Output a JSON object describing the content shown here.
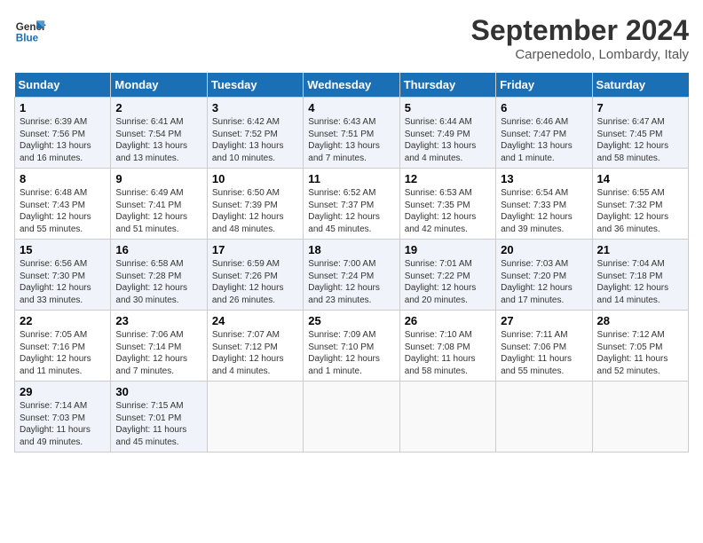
{
  "header": {
    "logo_line1": "General",
    "logo_line2": "Blue",
    "month_title": "September 2024",
    "location": "Carpenedolo, Lombardy, Italy"
  },
  "columns": [
    "Sunday",
    "Monday",
    "Tuesday",
    "Wednesday",
    "Thursday",
    "Friday",
    "Saturday"
  ],
  "weeks": [
    [
      {
        "day": "1",
        "info": "Sunrise: 6:39 AM\nSunset: 7:56 PM\nDaylight: 13 hours\nand 16 minutes."
      },
      {
        "day": "2",
        "info": "Sunrise: 6:41 AM\nSunset: 7:54 PM\nDaylight: 13 hours\nand 13 minutes."
      },
      {
        "day": "3",
        "info": "Sunrise: 6:42 AM\nSunset: 7:52 PM\nDaylight: 13 hours\nand 10 minutes."
      },
      {
        "day": "4",
        "info": "Sunrise: 6:43 AM\nSunset: 7:51 PM\nDaylight: 13 hours\nand 7 minutes."
      },
      {
        "day": "5",
        "info": "Sunrise: 6:44 AM\nSunset: 7:49 PM\nDaylight: 13 hours\nand 4 minutes."
      },
      {
        "day": "6",
        "info": "Sunrise: 6:46 AM\nSunset: 7:47 PM\nDaylight: 13 hours\nand 1 minute."
      },
      {
        "day": "7",
        "info": "Sunrise: 6:47 AM\nSunset: 7:45 PM\nDaylight: 12 hours\nand 58 minutes."
      }
    ],
    [
      {
        "day": "8",
        "info": "Sunrise: 6:48 AM\nSunset: 7:43 PM\nDaylight: 12 hours\nand 55 minutes."
      },
      {
        "day": "9",
        "info": "Sunrise: 6:49 AM\nSunset: 7:41 PM\nDaylight: 12 hours\nand 51 minutes."
      },
      {
        "day": "10",
        "info": "Sunrise: 6:50 AM\nSunset: 7:39 PM\nDaylight: 12 hours\nand 48 minutes."
      },
      {
        "day": "11",
        "info": "Sunrise: 6:52 AM\nSunset: 7:37 PM\nDaylight: 12 hours\nand 45 minutes."
      },
      {
        "day": "12",
        "info": "Sunrise: 6:53 AM\nSunset: 7:35 PM\nDaylight: 12 hours\nand 42 minutes."
      },
      {
        "day": "13",
        "info": "Sunrise: 6:54 AM\nSunset: 7:33 PM\nDaylight: 12 hours\nand 39 minutes."
      },
      {
        "day": "14",
        "info": "Sunrise: 6:55 AM\nSunset: 7:32 PM\nDaylight: 12 hours\nand 36 minutes."
      }
    ],
    [
      {
        "day": "15",
        "info": "Sunrise: 6:56 AM\nSunset: 7:30 PM\nDaylight: 12 hours\nand 33 minutes."
      },
      {
        "day": "16",
        "info": "Sunrise: 6:58 AM\nSunset: 7:28 PM\nDaylight: 12 hours\nand 30 minutes."
      },
      {
        "day": "17",
        "info": "Sunrise: 6:59 AM\nSunset: 7:26 PM\nDaylight: 12 hours\nand 26 minutes."
      },
      {
        "day": "18",
        "info": "Sunrise: 7:00 AM\nSunset: 7:24 PM\nDaylight: 12 hours\nand 23 minutes."
      },
      {
        "day": "19",
        "info": "Sunrise: 7:01 AM\nSunset: 7:22 PM\nDaylight: 12 hours\nand 20 minutes."
      },
      {
        "day": "20",
        "info": "Sunrise: 7:03 AM\nSunset: 7:20 PM\nDaylight: 12 hours\nand 17 minutes."
      },
      {
        "day": "21",
        "info": "Sunrise: 7:04 AM\nSunset: 7:18 PM\nDaylight: 12 hours\nand 14 minutes."
      }
    ],
    [
      {
        "day": "22",
        "info": "Sunrise: 7:05 AM\nSunset: 7:16 PM\nDaylight: 12 hours\nand 11 minutes."
      },
      {
        "day": "23",
        "info": "Sunrise: 7:06 AM\nSunset: 7:14 PM\nDaylight: 12 hours\nand 7 minutes."
      },
      {
        "day": "24",
        "info": "Sunrise: 7:07 AM\nSunset: 7:12 PM\nDaylight: 12 hours\nand 4 minutes."
      },
      {
        "day": "25",
        "info": "Sunrise: 7:09 AM\nSunset: 7:10 PM\nDaylight: 12 hours\nand 1 minute."
      },
      {
        "day": "26",
        "info": "Sunrise: 7:10 AM\nSunset: 7:08 PM\nDaylight: 11 hours\nand 58 minutes."
      },
      {
        "day": "27",
        "info": "Sunrise: 7:11 AM\nSunset: 7:06 PM\nDaylight: 11 hours\nand 55 minutes."
      },
      {
        "day": "28",
        "info": "Sunrise: 7:12 AM\nSunset: 7:05 PM\nDaylight: 11 hours\nand 52 minutes."
      }
    ],
    [
      {
        "day": "29",
        "info": "Sunrise: 7:14 AM\nSunset: 7:03 PM\nDaylight: 11 hours\nand 49 minutes."
      },
      {
        "day": "30",
        "info": "Sunrise: 7:15 AM\nSunset: 7:01 PM\nDaylight: 11 hours\nand 45 minutes."
      },
      null,
      null,
      null,
      null,
      null
    ]
  ]
}
